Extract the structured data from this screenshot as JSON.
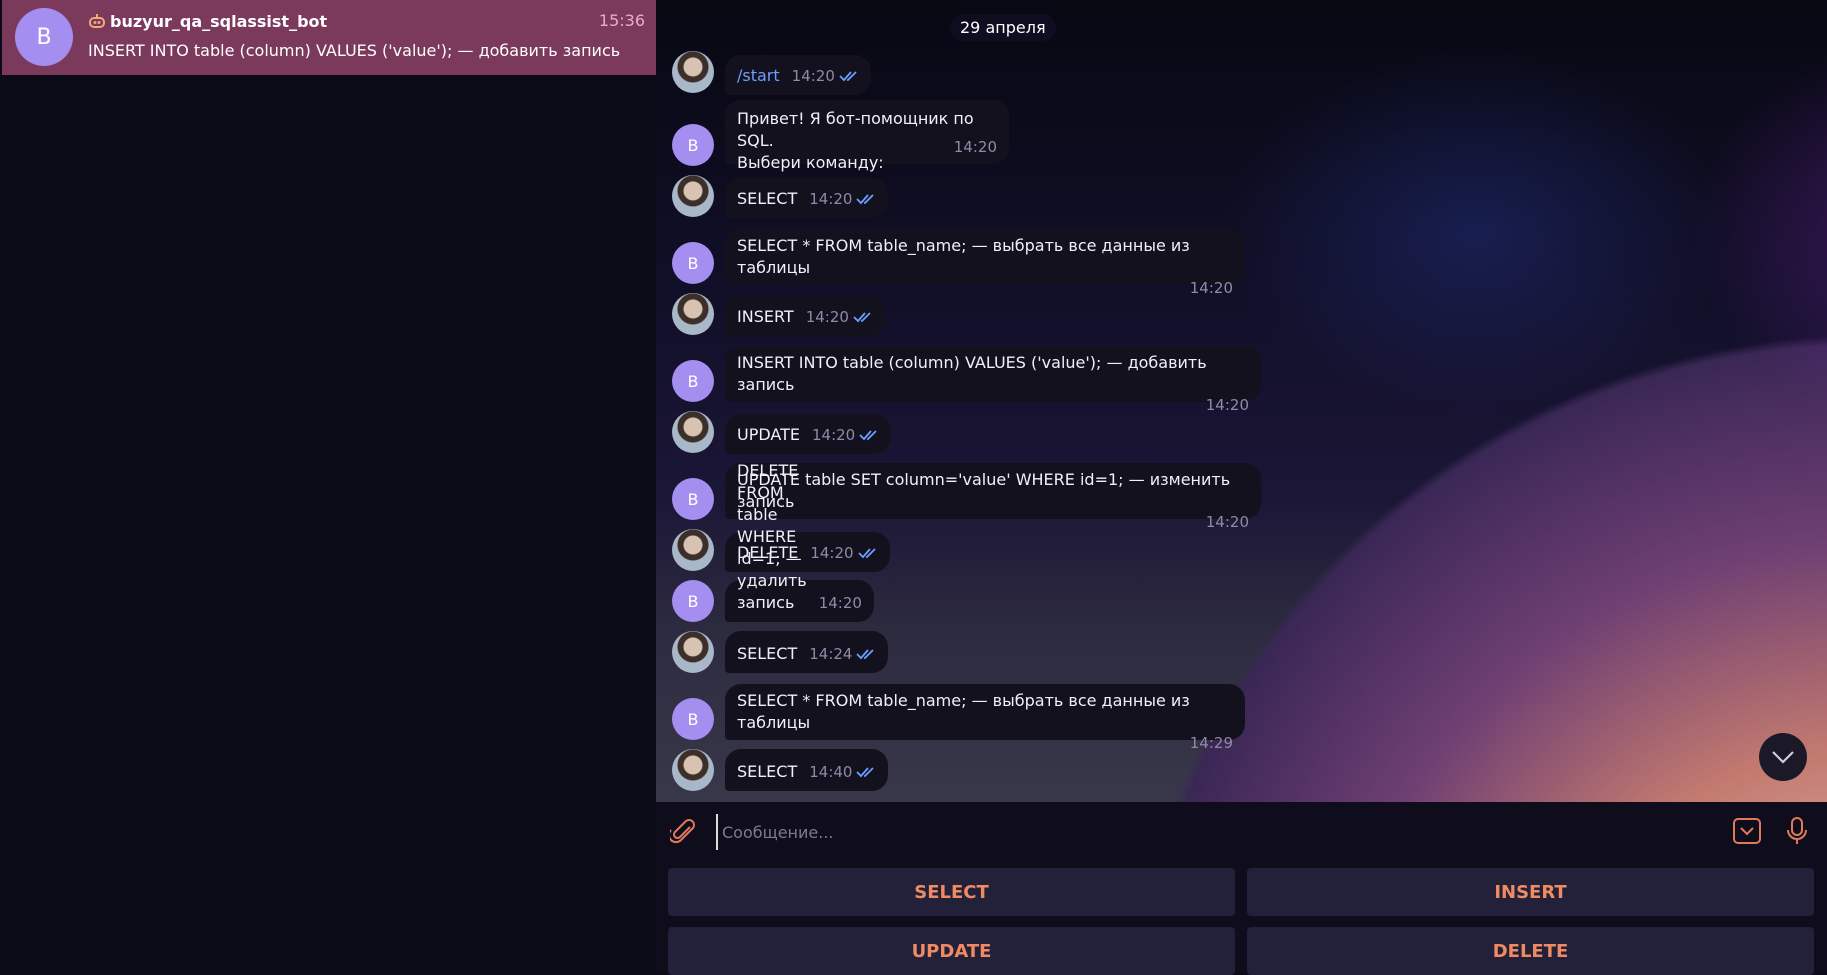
{
  "sidebar": {
    "chat": {
      "avatar_letter": "B",
      "name": "buzyur_qa_sqlassist_bot",
      "time": "15:36",
      "preview": "INSERT INTO table (column) VALUES ('value'); — добавить запись"
    }
  },
  "chat": {
    "date": "29 апреля",
    "bot_avatar_letter": "B",
    "messages": [
      {
        "from": "user",
        "text": "/start",
        "time": "14:20"
      },
      {
        "from": "bot",
        "text": "Привет! Я бот-помощник по SQL.\nВыбери команду:",
        "time": "14:20"
      },
      {
        "from": "user",
        "text": "SELECT",
        "time": "14:20"
      },
      {
        "from": "bot",
        "text": "SELECT * FROM table_name; — выбрать все данные из таблицы",
        "time": "14:20"
      },
      {
        "from": "user",
        "text": "INSERT",
        "time": "14:20"
      },
      {
        "from": "bot",
        "text": "INSERT INTO table (column) VALUES ('value'); — добавить запись",
        "time": "14:20"
      },
      {
        "from": "user",
        "text": "UPDATE",
        "time": "14:20"
      },
      {
        "from": "bot",
        "text": "UPDATE table SET column='value' WHERE id=1; — изменить запись",
        "time": "14:20"
      },
      {
        "from": "user",
        "text": "DELETE",
        "time": "14:20"
      },
      {
        "from": "bot",
        "text": "DELETE FROM table WHERE id=1; — удалить запись",
        "time": "14:20"
      },
      {
        "from": "user",
        "text": "SELECT",
        "time": "14:24"
      },
      {
        "from": "bot",
        "text": "SELECT * FROM table_name; — выбрать все данные из таблицы",
        "time": "14:29"
      },
      {
        "from": "user",
        "text": "SELECT",
        "time": "14:40"
      }
    ]
  },
  "composer": {
    "placeholder": "Сообщение..."
  },
  "keyboard": {
    "select": "SELECT",
    "insert": "INSERT",
    "update": "UPDATE",
    "delete": "DELETE"
  },
  "colors": {
    "accent": "#f08a62",
    "active_chat": "#7b3a5c",
    "avatar": "#a48ef0",
    "check": "#6a9fff"
  },
  "icons": [
    "bot-icon",
    "double-check-icon",
    "chevron-down-icon",
    "paperclip-icon",
    "keyboard-icon",
    "microphone-icon"
  ]
}
